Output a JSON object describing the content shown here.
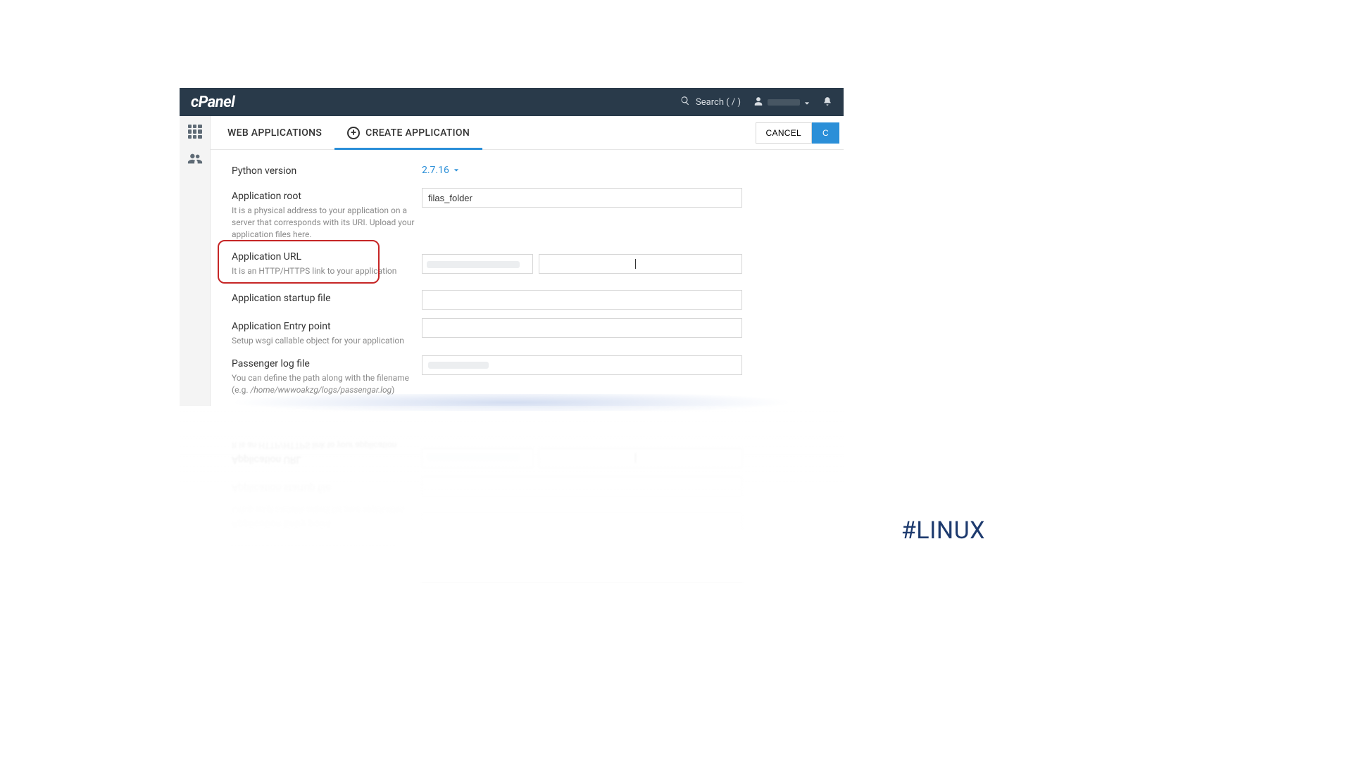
{
  "brand": "cPanel",
  "topbar": {
    "search_placeholder": "Search ( / )"
  },
  "tabs": {
    "web_apps": "WEB APPLICATIONS",
    "create_app": "CREATE APPLICATION"
  },
  "buttons": {
    "cancel": "CANCEL",
    "create_partial": "C"
  },
  "form": {
    "python_version": {
      "label": "Python version",
      "value": "2.7.16"
    },
    "app_root": {
      "label": "Application root",
      "desc": "It is a physical address to your application on a server that corresponds with its URI. Upload your application files here.",
      "value": "filas_folder"
    },
    "app_url": {
      "label": "Application URL",
      "desc": "It is an HTTP/HTTPS link to your application"
    },
    "startup_file": {
      "label": "Application startup file"
    },
    "entry_point": {
      "label": "Application Entry point",
      "desc": "Setup wsgi callable object for your application"
    },
    "passenger_log": {
      "label": "Passenger log file",
      "desc_pre": "You can define the path along with the filename (e.g. ",
      "desc_path": "/home/wwwoakzg/logs/passengar.log",
      "desc_post": ")"
    }
  },
  "hashtag": "#LINUX"
}
